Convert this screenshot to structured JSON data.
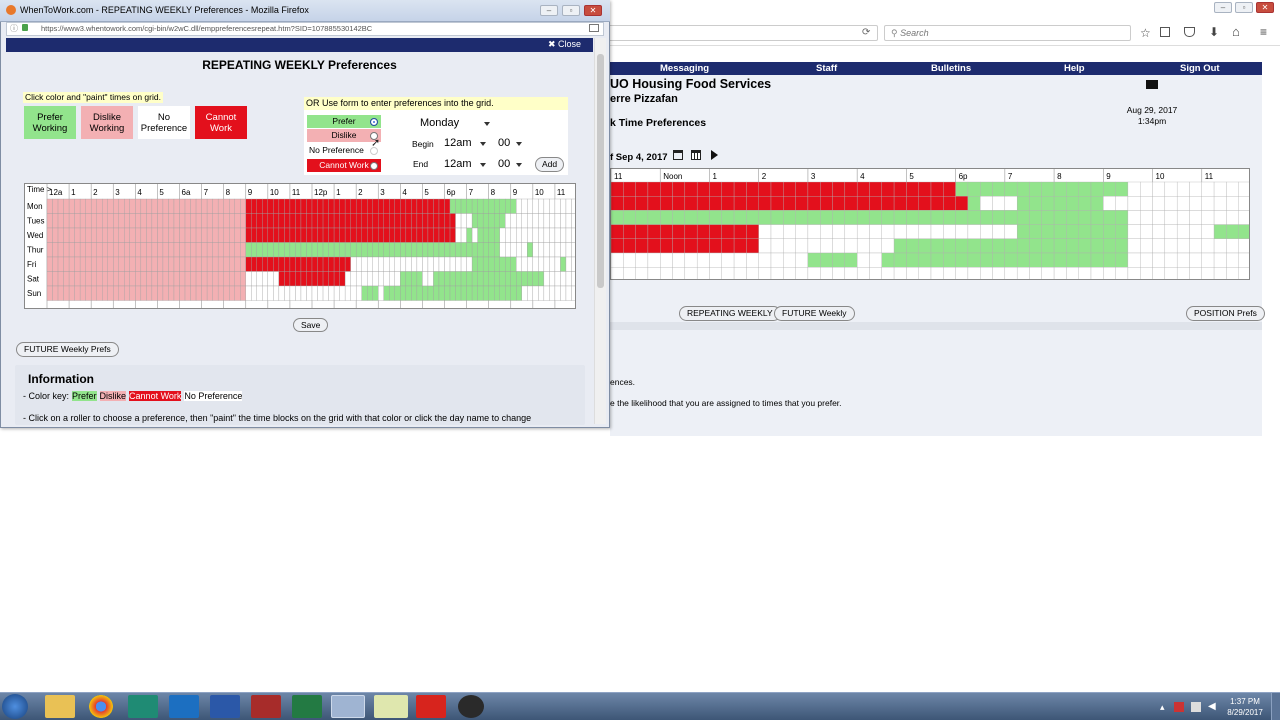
{
  "popup": {
    "window_title": "WhenToWork.com - REPEATING WEEKLY Preferences - Mozilla Firefox",
    "url": "https://www3.whentowork.com/cgi-bin/w2wC.dll/emppreferencesrepeat.htm?SID=107885530142BC",
    "close_label": "✖ Close",
    "heading": "REPEATING WEEKLY Preferences",
    "hint": "Click color and \"paint\" times on grid.",
    "swatches": [
      {
        "line1": "Prefer",
        "line2": "Working",
        "color": "#92e48c"
      },
      {
        "line1": "Dislike",
        "line2": "Working",
        "color": "#f3b0b3"
      },
      {
        "line1": "No",
        "line2": "Preference",
        "color": "#ffffff"
      },
      {
        "line1": "Cannot",
        "line2": "Work",
        "color": "#e3101c"
      }
    ],
    "form_hint": "OR Use form to enter preferences into the grid.",
    "rollers": [
      {
        "label": "Prefer",
        "color": "#92e48c",
        "checked": true
      },
      {
        "label": "Dislike",
        "color": "#f3b0b3",
        "checked": false
      },
      {
        "label": "No Preference",
        "color": "#ffffff",
        "checked": false
      },
      {
        "label": "Cannot Work",
        "color": "#e3101c",
        "checked": false
      }
    ],
    "day_select": "Monday",
    "begin_label": "Begin",
    "end_label": "End",
    "begin_hour": "12am",
    "begin_min": "00",
    "end_hour": "12am",
    "end_min": "00",
    "add_label": "Add",
    "grid": {
      "corner": "Time >",
      "hours": [
        "12a",
        "1",
        "2",
        "3",
        "4",
        "5",
        "6a",
        "7",
        "8",
        "9",
        "10",
        "11",
        "12p",
        "1",
        "2",
        "3",
        "4",
        "5",
        "6p",
        "7",
        "8",
        "9",
        "10",
        "11"
      ],
      "days": [
        "Mon",
        "Tues",
        "Wed",
        "Thur",
        "Fri",
        "Sat",
        "Sun"
      ],
      "legend": {
        "P": "#92e48c",
        "D": "#f3b0b3",
        "C": "#e3101c",
        "N": "#ffffff"
      },
      "rows": [
        "DDDDDDDDDDDDDDDDDDDDDDDDDDDDDDDDDDDDCCCCCCCCCCCCCCCCCCCCCCCCCCCCCCCCCCCCCPPPPPPPPPPPPNNNNNNNNNNN",
        "DDDDDDDDDDDDDDDDDDDDDDDDDDDDDDDDDDDDCCCCCCCCCCCCCCCCCCCCCCCCCCCCCCCCCCCCCCNNNPPPPPPNNNNNNNNNNNNNN",
        "DDDDDDDDDDDDDDDDDDDDDDDDDDDDDDDDDDDDCCCCCCCCCCCCCCCCCCCCCCCCCCCCCCCCCCCCCCNNPNPPPPNNNNNNNNNNNNNNN",
        "DDDDDDDDDDDDDDDDDDDDDDDDDDDDDDDDDDDDPPPPPPPPPPPPPPPPPPPPPPPPPPPPPPPPPPPPPPPPPPPPPPNNNNNPNNNNNNNNN",
        "DDDDDDDDDDDDDDDDDDDDDDDDDDDDDDDDDDDDCCCCCCCCCCCCCCCCCCCNNNNNNNNNNNNNNNNNNNNNNPPPPPPPPNNNNNNNNPNNNN",
        "DDDDDDDDDDDDDDDDDDDDDDDDDDDDDDDDDDDDNNNNNNCCCCCCCCCCCCNNNNNNNNNNPPPPNNPPPPPPPPPPPPPPPPPPPPNNNNNNN",
        "DDDDDDDDDDDDDDDDDDDDDDDDDDDDDDDDDDDDNNNNNNNNNNNNNNNNNNNNNPPPNPPPPPPPPPPPPPPPPPPPPPPPPPNNNNNNNNNNN"
      ]
    },
    "save_label": "Save",
    "future_label": "FUTURE Weekly Prefs",
    "info_title": "Information",
    "color_key_label": "- Color key:",
    "key_prefer": "Prefer",
    "key_dislike": "Dislike",
    "key_cannot": "Cannot Work",
    "key_nopref": "No Preference",
    "info_line2": "- Click on a roller to choose a preference, then \"paint\" the time blocks on the grid with that color or click the day name to change"
  },
  "main": {
    "search_placeholder": "Search",
    "menu": [
      "Messaging",
      "Staff",
      "Bulletins",
      "Help",
      "Sign Out"
    ],
    "org_name": "UO Housing Food Services",
    "user_name": "erre Pizzafan",
    "date": "Aug 29, 2017",
    "time": "1:34pm",
    "page_title": "k Time Preferences",
    "week_label": "f Sep 4, 2017",
    "hours": [
      "11",
      "Noon",
      "1",
      "2",
      "3",
      "4",
      "5",
      "6p",
      "7",
      "8",
      "9",
      "10",
      "11"
    ],
    "buttons": [
      "REPEATING WEEKLY",
      "FUTURE Weekly",
      "POSITION Prefs"
    ],
    "text1": "ences.",
    "text2": "e the likelihood that you are assigned to times that you prefer."
  },
  "taskbar": {
    "time": "1:37 PM",
    "date": "8/29/2017",
    "apps": [
      "file-explorer-icon",
      "chrome-icon",
      "publisher-icon",
      "outlook-icon",
      "word-icon",
      "access-icon",
      "excel-icon",
      "firefox-icon",
      "folder-icon",
      "acrobat-icon",
      "obs-icon"
    ]
  }
}
